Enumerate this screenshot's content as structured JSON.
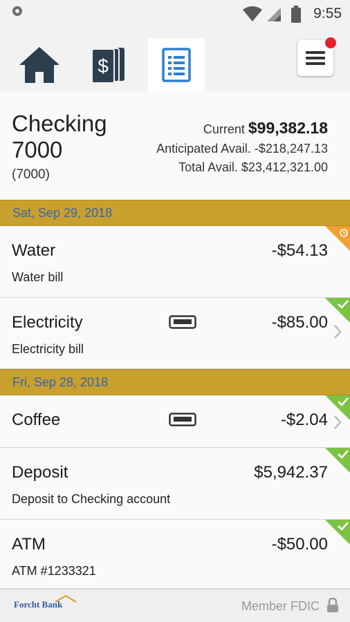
{
  "status_bar": {
    "time": "9:55"
  },
  "nav": {
    "tabs": [
      {
        "name": "home-tab",
        "icon": "home-icon"
      },
      {
        "name": "accounts-tab",
        "icon": "dollar-icon"
      },
      {
        "name": "transactions-tab",
        "icon": "document-list-icon",
        "active": true
      }
    ],
    "menu_icon": "hamburger-icon",
    "notification_color": "#e5202a"
  },
  "account": {
    "name": "Checking 7000",
    "sub": "(7000)",
    "current_label": "Current",
    "current_value": "$99,382.18",
    "anticipated": "Anticipated Avail. -$218,247.13",
    "total": "Total Avail. $23,412,321.00"
  },
  "dates": [
    "Sat, Sep 29, 2018",
    "Fri, Sep 28, 2018"
  ],
  "transactions": [
    {
      "name": "Water",
      "desc": "Water bill",
      "amount": "-$54.13",
      "status": "pending"
    },
    {
      "name": "Electricity",
      "desc": "Electricity bill",
      "amount": "-$85.00",
      "status": "cleared",
      "card": true
    },
    {
      "name": "Coffee",
      "desc": "",
      "amount": "-$2.04",
      "status": "cleared",
      "card": true
    },
    {
      "name": "Deposit",
      "desc": "Deposit to Checking account",
      "amount": "$5,942.37",
      "status": "cleared"
    },
    {
      "name": "ATM",
      "desc": "ATM #1233321",
      "amount": "-$50.00",
      "status": "cleared"
    }
  ],
  "colors": {
    "date_bar": "#c7a02e",
    "cleared": "#7cc243",
    "pending": "#f0a030",
    "accent": "#2c7fd1"
  },
  "footer": {
    "logo": "Forcht Bank",
    "fdic": "Member FDIC"
  }
}
